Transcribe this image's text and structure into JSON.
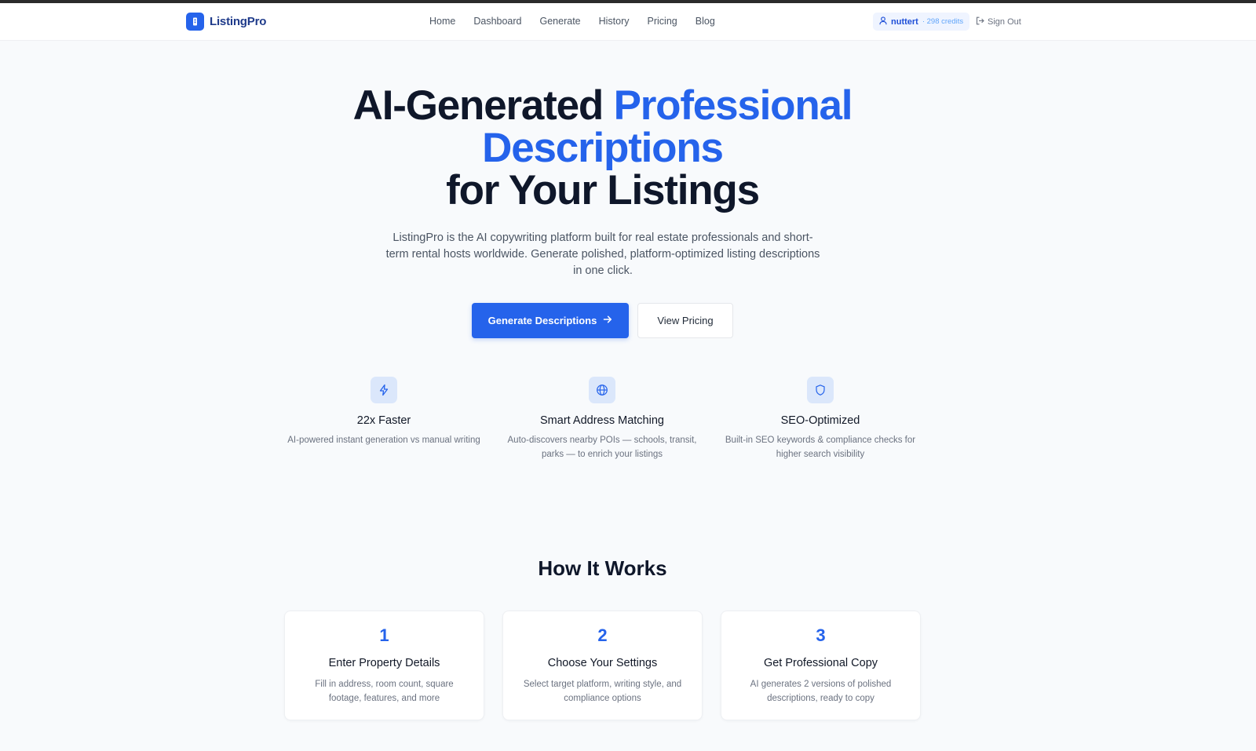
{
  "nav": {
    "brand": "ListingPro",
    "links": [
      "Home",
      "Dashboard",
      "Generate",
      "History",
      "Pricing",
      "Blog"
    ],
    "user": "nuttert",
    "credits": "· 298 credits",
    "sign_out": "Sign Out"
  },
  "hero": {
    "title_part1": "AI-Generated ",
    "title_highlight1": "Professional",
    "title_highlight2": "Descriptions",
    "title_part2": "for Your Listings",
    "subtitle": "ListingPro is the AI copywriting platform built for real estate professionals and short-term rental hosts worldwide. Generate polished, platform-optimized listing descriptions in one click.",
    "primary_button": "Generate Descriptions",
    "secondary_button": "View Pricing"
  },
  "features": [
    {
      "icon": "lightning-icon",
      "title": "22x Faster",
      "desc": "AI-powered instant generation vs manual writing"
    },
    {
      "icon": "globe-icon",
      "title": "Smart Address Matching",
      "desc": "Auto-discovers nearby POIs — schools, transit, parks — to enrich your listings"
    },
    {
      "icon": "shield-icon",
      "title": "SEO-Optimized",
      "desc": "Built-in SEO keywords & compliance checks for higher search visibility"
    }
  ],
  "how_it_works": {
    "title": "How It Works",
    "steps": [
      {
        "num": "1",
        "title": "Enter Property Details",
        "desc": "Fill in address, room count, square footage, features, and more"
      },
      {
        "num": "2",
        "title": "Choose Your Settings",
        "desc": "Select target platform, writing style, and compliance options"
      },
      {
        "num": "3",
        "title": "Get Professional Copy",
        "desc": "AI generates 2 versions of polished descriptions, ready to copy"
      }
    ]
  },
  "colors": {
    "accent": "#2563eb",
    "text": "#0f172a",
    "muted": "#6b7280",
    "background": "#f8fafc"
  }
}
